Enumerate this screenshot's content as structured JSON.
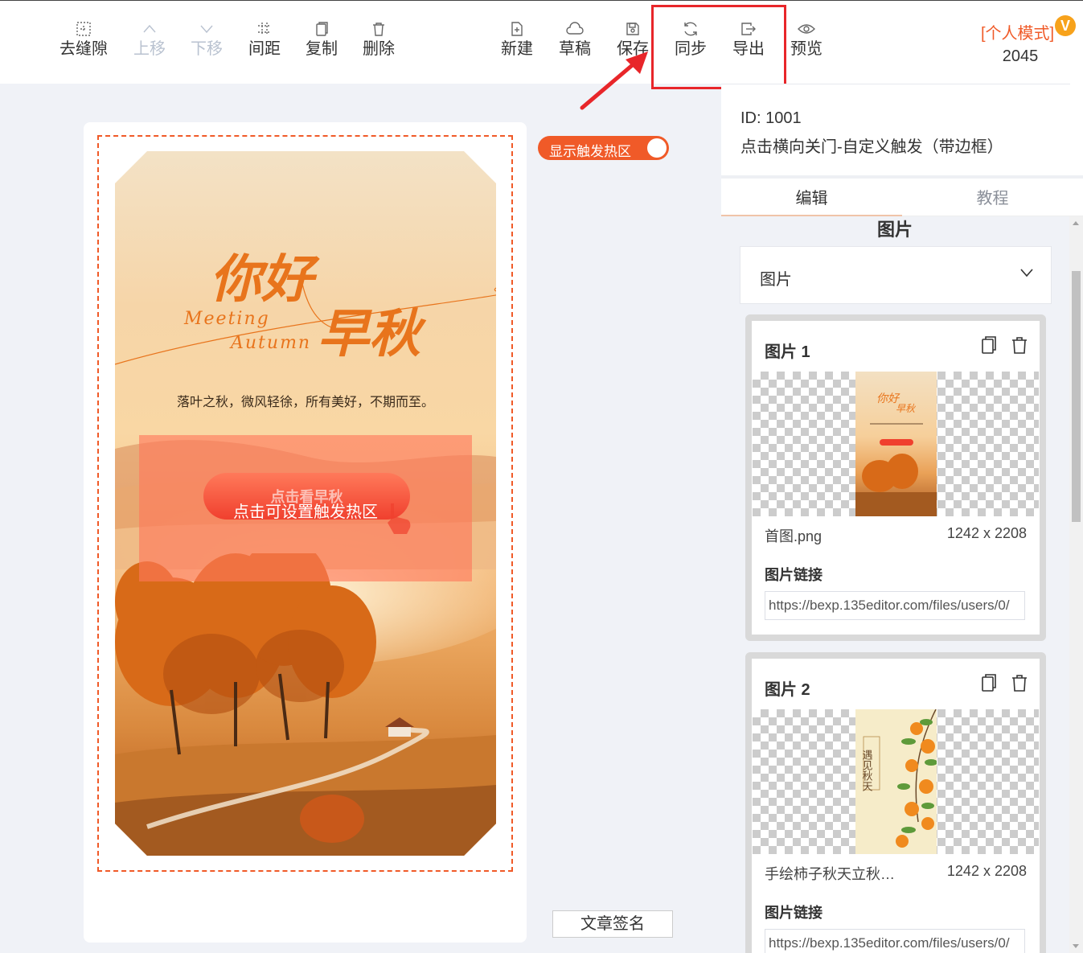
{
  "toolbar": {
    "left_tools": [
      {
        "label": "去缝隙",
        "icon": "gap-icon",
        "enabled": true
      },
      {
        "label": "上移",
        "icon": "chevron-up-icon",
        "enabled": false
      },
      {
        "label": "下移",
        "icon": "chevron-down-icon",
        "enabled": false
      },
      {
        "label": "间距",
        "icon": "spacing-icon",
        "enabled": true
      },
      {
        "label": "复制",
        "icon": "copy-icon",
        "enabled": true
      },
      {
        "label": "删除",
        "icon": "trash-icon",
        "enabled": true
      }
    ],
    "right_tools": [
      {
        "label": "新建",
        "icon": "new-file-icon"
      },
      {
        "label": "草稿",
        "icon": "cloud-icon"
      },
      {
        "label": "保存",
        "icon": "save-icon"
      },
      {
        "label": "同步",
        "icon": "sync-icon"
      },
      {
        "label": "导出",
        "icon": "export-icon"
      },
      {
        "label": "预览",
        "icon": "eye-icon"
      }
    ],
    "mode_label": "[个人模式]",
    "vip_badge": "V",
    "count": "2045"
  },
  "canvas": {
    "hotzone_toggle_label": "显示触发热区",
    "hotzone_hint": "点击可设置触发热区",
    "signature_button": "文章签名",
    "poster": {
      "title_line1": "你好",
      "title_line2": "早秋",
      "subtitle_line1": "Meeting",
      "subtitle_line2": "Autumn",
      "tagline": "落叶之秋，微风轻徐，所有美好，不期而至。",
      "button_text": "点击看早秋"
    }
  },
  "panel": {
    "id_text": "ID: 1001",
    "template_name": "点击横向关门-自定义触发（带边框）",
    "tabs": [
      "编辑",
      "教程"
    ],
    "section_title": "图片",
    "collapse_label": "图片",
    "images": [
      {
        "title": "图片 1",
        "filename": "首图.png",
        "dimensions": "1242 x 2208",
        "link_label": "图片链接",
        "link_value": "https://bexp.135editor.com/files/users/0/"
      },
      {
        "title": "图片 2",
        "filename": "手绘柿子秋天立秋…",
        "dimensions": "1242 x 2208",
        "link_label": "图片链接",
        "link_value": "https://bexp.135editor.com/files/users/0/"
      }
    ],
    "thumb2_text": "遇见秋天"
  },
  "colors": {
    "accent": "#f05a28",
    "highlight": "#e8262a",
    "vip": "#f7a21b"
  }
}
